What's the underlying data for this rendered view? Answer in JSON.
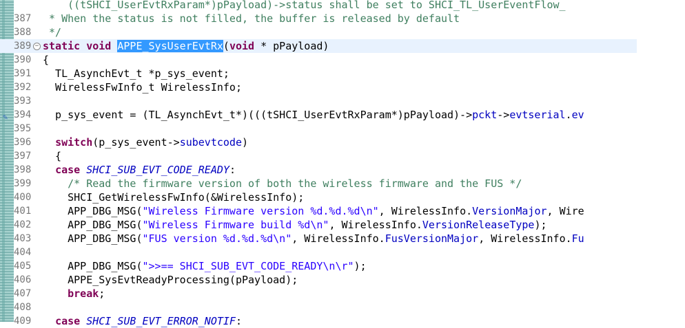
{
  "editor": {
    "lines": [
      {
        "num": "",
        "tokens": [
          {
            "t": "    ((tSHCI_UserEvtRxParam*)pPayload)->status shall be set to SHCI_TL_UserEventFlow_",
            "c": "cm"
          }
        ]
      },
      {
        "num": "387",
        "tokens": [
          {
            "t": " * When the status is not filled, the buffer is released by default",
            "c": "cm"
          }
        ]
      },
      {
        "num": "388",
        "tokens": [
          {
            "t": " */",
            "c": "cm"
          }
        ]
      },
      {
        "num": "389",
        "fold": "−",
        "current": true,
        "tokens": [
          {
            "t": "static",
            "c": "kw"
          },
          {
            "t": " "
          },
          {
            "t": "void",
            "c": "kw"
          },
          {
            "t": " "
          },
          {
            "t": "APPE_SysUserEvtRx",
            "c": "sel"
          },
          {
            "t": "("
          },
          {
            "t": "void",
            "c": "kw"
          },
          {
            "t": " * pPayload)"
          }
        ]
      },
      {
        "num": "390",
        "tokens": [
          {
            "t": "{"
          }
        ]
      },
      {
        "num": "391",
        "tokens": [
          {
            "t": "  TL_AsynchEvt_t *p_sys_event;"
          }
        ]
      },
      {
        "num": "392",
        "tokens": [
          {
            "t": "  WirelessFwInfo_t WirelessInfo;"
          }
        ]
      },
      {
        "num": "393",
        "tokens": []
      },
      {
        "num": "394",
        "mark": true,
        "tokens": [
          {
            "t": "  p_sys_event = (TL_AsynchEvt_t*)(((tSHCI_UserEvtRxParam*)pPayload)->"
          },
          {
            "t": "pckt",
            "c": "field"
          },
          {
            "t": "->"
          },
          {
            "t": "evtserial",
            "c": "field"
          },
          {
            "t": "."
          },
          {
            "t": "ev",
            "c": "field"
          }
        ]
      },
      {
        "num": "395",
        "tokens": []
      },
      {
        "num": "396",
        "tokens": [
          {
            "t": "  "
          },
          {
            "t": "switch",
            "c": "kw"
          },
          {
            "t": "(p_sys_event->"
          },
          {
            "t": "subevtcode",
            "c": "field"
          },
          {
            "t": ")"
          }
        ]
      },
      {
        "num": "397",
        "tokens": [
          {
            "t": "  {"
          }
        ]
      },
      {
        "num": "398",
        "tokens": [
          {
            "t": "  "
          },
          {
            "t": "case",
            "c": "kw"
          },
          {
            "t": " "
          },
          {
            "t": "SHCI_SUB_EVT_CODE_READY",
            "c": "macro"
          },
          {
            "t": ":"
          }
        ]
      },
      {
        "num": "399",
        "tokens": [
          {
            "t": "    "
          },
          {
            "t": "/* Read the firmware version of both the wireless firmware and the FUS */",
            "c": "cm"
          }
        ]
      },
      {
        "num": "400",
        "tokens": [
          {
            "t": "    SHCI_GetWirelessFwInfo(&WirelessInfo);"
          }
        ]
      },
      {
        "num": "401",
        "tokens": [
          {
            "t": "    APP_DBG_MSG("
          },
          {
            "t": "\"Wireless Firmware version %d.%d.%d\\n\"",
            "c": "str"
          },
          {
            "t": ", WirelessInfo."
          },
          {
            "t": "VersionMajor",
            "c": "field"
          },
          {
            "t": ", Wire"
          }
        ]
      },
      {
        "num": "402",
        "tokens": [
          {
            "t": "    APP_DBG_MSG("
          },
          {
            "t": "\"Wireless Firmware build %d\\n\"",
            "c": "str"
          },
          {
            "t": ", WirelessInfo."
          },
          {
            "t": "VersionReleaseType",
            "c": "field"
          },
          {
            "t": ");"
          }
        ]
      },
      {
        "num": "403",
        "tokens": [
          {
            "t": "    APP_DBG_MSG("
          },
          {
            "t": "\"FUS version %d.%d.%d\\n\"",
            "c": "str"
          },
          {
            "t": ", WirelessInfo."
          },
          {
            "t": "FusVersionMajor",
            "c": "field"
          },
          {
            "t": ", WirelessInfo."
          },
          {
            "t": "Fu",
            "c": "field"
          }
        ]
      },
      {
        "num": "404",
        "tokens": []
      },
      {
        "num": "405",
        "tokens": [
          {
            "t": "    APP_DBG_MSG("
          },
          {
            "t": "\">>== SHCI_SUB_EVT_CODE_READY\\n\\r\"",
            "c": "str"
          },
          {
            "t": ");"
          }
        ]
      },
      {
        "num": "406",
        "tokens": [
          {
            "t": "    APPE_SysEvtReadyProcessing(pPayload);"
          }
        ]
      },
      {
        "num": "407",
        "tokens": [
          {
            "t": "    "
          },
          {
            "t": "break",
            "c": "kw"
          },
          {
            "t": ";"
          }
        ]
      },
      {
        "num": "408",
        "tokens": []
      },
      {
        "num": "409",
        "tokens": [
          {
            "t": "  "
          },
          {
            "t": "case",
            "c": "kw"
          },
          {
            "t": " "
          },
          {
            "t": "SHCI_SUB_EVT_ERROR_NOTIF",
            "c": "macro"
          },
          {
            "t": ":"
          }
        ]
      }
    ]
  },
  "colors": {
    "keyword": "#7f0055",
    "comment": "#3f7f5f",
    "string": "#2a00ff",
    "field": "#0000c0",
    "selection": "#3399ff",
    "current_line": "#e8f2fe",
    "gutter": "#7fb5b2"
  },
  "icons": {
    "fold": "collapse-minus-icon",
    "edit_marker": "edit-pencil-icon"
  }
}
